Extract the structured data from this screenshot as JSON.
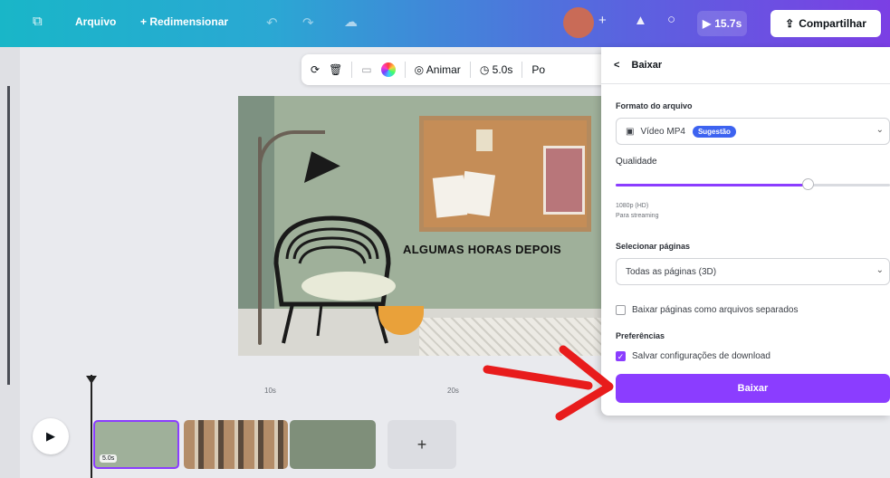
{
  "topbar": {
    "file_label": "Arquivo",
    "resize_label": "+ Redimensionar",
    "duration_label": "15.7s",
    "share_label": "Compartilhar"
  },
  "toolbar": {
    "animate_label": "Animar",
    "time_label": "5.0s",
    "overflow_label": "Po"
  },
  "canvas": {
    "headline": "ALGUMAS HORAS DEPOIS"
  },
  "panel": {
    "back_label": "<",
    "title": "Baixar",
    "file_format_label": "Formato do arquivo",
    "file_format_value": "Vídeo MP4",
    "suggested_badge": "Sugestão",
    "quality_label": "Qualidade",
    "quality_level": 0.7,
    "quality_hint_1": "1080p (HD)",
    "quality_hint_2": "Para streaming",
    "select_pages_label": "Selecionar páginas",
    "select_pages_value": "Todas as páginas (3D)",
    "separate_files_label": "Baixar páginas como arquivos separados",
    "preferences_label": "Preferências",
    "save_settings_label": "Salvar configurações de download",
    "download_button": "Baixar"
  },
  "timeline": {
    "tick_1": "10s",
    "tick_2": "20s",
    "clip_time": "5.0s",
    "add_label": "+"
  },
  "colors": {
    "accent": "#8b3dff",
    "arrow": "#e81c1c"
  }
}
